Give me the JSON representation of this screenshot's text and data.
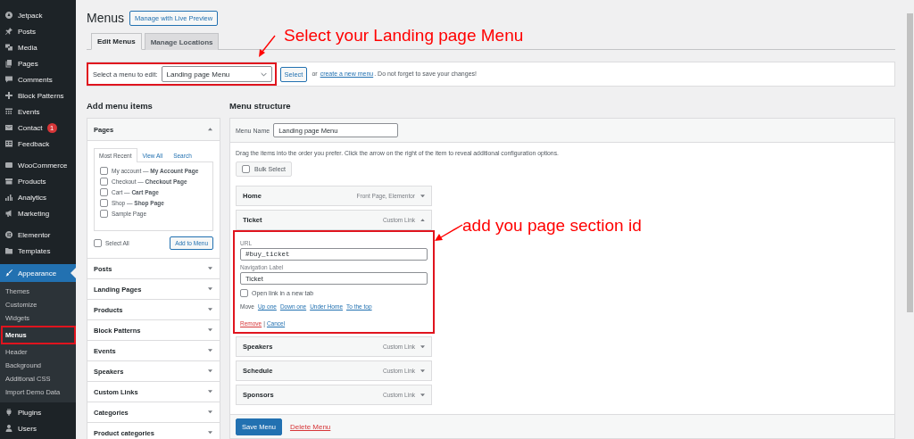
{
  "sidebar": {
    "groups": [
      [
        {
          "label": "Jetpack",
          "selected": false
        },
        {
          "label": "Posts",
          "selected": false
        },
        {
          "label": "Media",
          "selected": false
        },
        {
          "label": "Pages",
          "selected": false
        },
        {
          "label": "Comments",
          "selected": false
        },
        {
          "label": "Block Patterns",
          "selected": false
        },
        {
          "label": "Events",
          "selected": false
        },
        {
          "label": "Contact",
          "badge": "1",
          "selected": false
        },
        {
          "label": "Feedback",
          "selected": false
        }
      ],
      [
        {
          "label": "WooCommerce",
          "selected": false
        },
        {
          "label": "Products",
          "selected": false
        },
        {
          "label": "Analytics",
          "selected": false
        },
        {
          "label": "Marketing",
          "selected": false
        }
      ],
      [
        {
          "label": "Elementor",
          "selected": false
        },
        {
          "label": "Templates",
          "selected": false
        }
      ],
      [
        {
          "label": "Appearance",
          "selected": true,
          "children": [
            {
              "label": "Themes",
              "selected": false,
              "highlighted": false
            },
            {
              "label": "Customize",
              "selected": false,
              "highlighted": false
            },
            {
              "label": "Widgets",
              "selected": false,
              "highlighted": false
            },
            {
              "label": "Menus",
              "selected": true,
              "highlighted": true
            },
            {
              "label": "Header",
              "selected": false,
              "highlighted": false
            },
            {
              "label": "Background",
              "selected": false,
              "highlighted": false
            },
            {
              "label": "Additional CSS",
              "selected": false,
              "highlighted": false
            },
            {
              "label": "Import Demo Data",
              "selected": false,
              "highlighted": false
            }
          ]
        },
        {
          "label": "Plugins",
          "selected": false
        },
        {
          "label": "Users",
          "selected": false
        }
      ]
    ]
  },
  "page": {
    "title": "Menus",
    "preview_button": "Manage with Live Preview"
  },
  "tabs": [
    {
      "label": "Edit Menus",
      "selected": true
    },
    {
      "label": "Manage Locations",
      "selected": false
    }
  ],
  "manage_bar": {
    "label": "Select a menu to edit:",
    "value": "Landing page Menu",
    "highlighted": true,
    "button": "Select",
    "text_before": "or",
    "link": "create a new menu",
    "text_after": ". Do not forget to save your changes!"
  },
  "add_items": {
    "heading": "Add menu items",
    "pages": {
      "title": "Pages",
      "expanded": true,
      "tabs": [
        {
          "label": "Most Recent",
          "selected": true
        },
        {
          "label": "View All",
          "selected": false
        },
        {
          "label": "Search",
          "selected": false
        }
      ],
      "items": [
        {
          "label": "My account — **My Account Page**",
          "checked": false
        },
        {
          "label": "Checkout — **Checkout Page**",
          "checked": false
        },
        {
          "label": "Cart — **Cart Page**",
          "checked": false
        },
        {
          "label": "Shop — **Shop Page**",
          "checked": false
        },
        {
          "label": "Sample Page",
          "checked": false
        }
      ],
      "select_all": {
        "label": "Select All",
        "checked": false
      },
      "button": "Add to Menu"
    },
    "sections": [
      {
        "title": "Posts",
        "expanded": false
      },
      {
        "title": "Landing Pages",
        "expanded": false
      },
      {
        "title": "Products",
        "expanded": false
      },
      {
        "title": "Block Patterns",
        "expanded": false
      },
      {
        "title": "Events",
        "expanded": false
      },
      {
        "title": "Speakers",
        "expanded": false
      },
      {
        "title": "Custom Links",
        "expanded": false
      },
      {
        "title": "Categories",
        "expanded": false
      },
      {
        "title": "Product categories",
        "expanded": false
      }
    ]
  },
  "structure": {
    "heading": "Menu structure",
    "name_label": "Menu Name",
    "name_value": "Landing page Menu",
    "instructions": "Drag the items into the order you prefer. Click the arrow on the right of the item to reveal additional configuration options.",
    "bulk_select": {
      "label": "Bulk Select",
      "checked": false
    },
    "items": [
      {
        "title": "Home",
        "type": "Front Page, Elementor",
        "expanded": false
      },
      {
        "title": "Ticket",
        "type": "Custom Link",
        "expanded": true,
        "highlighted": true,
        "url_label": "URL",
        "url": "#buy_ticket",
        "nav_label": "Navigation Label",
        "nav_value": "Ticket",
        "new_tab": {
          "label": "Open link in a new tab",
          "checked": false
        },
        "move_label": "Move",
        "move_links": [
          "Up one",
          "Down one",
          "Under Home",
          "To the top"
        ],
        "remove": "Remove",
        "separator": "|",
        "cancel": "Cancel"
      },
      {
        "title": "Speakers",
        "type": "Custom Link",
        "expanded": false
      },
      {
        "title": "Schedule",
        "type": "Custom Link",
        "expanded": false
      },
      {
        "title": "Sponsors",
        "type": "Custom Link",
        "expanded": false
      }
    ],
    "save_button": "Save Menu",
    "delete_link": "Delete Menu"
  },
  "annotations": [
    {
      "text": "Select your Landing page Menu"
    },
    {
      "text": "add you page section id"
    }
  ]
}
